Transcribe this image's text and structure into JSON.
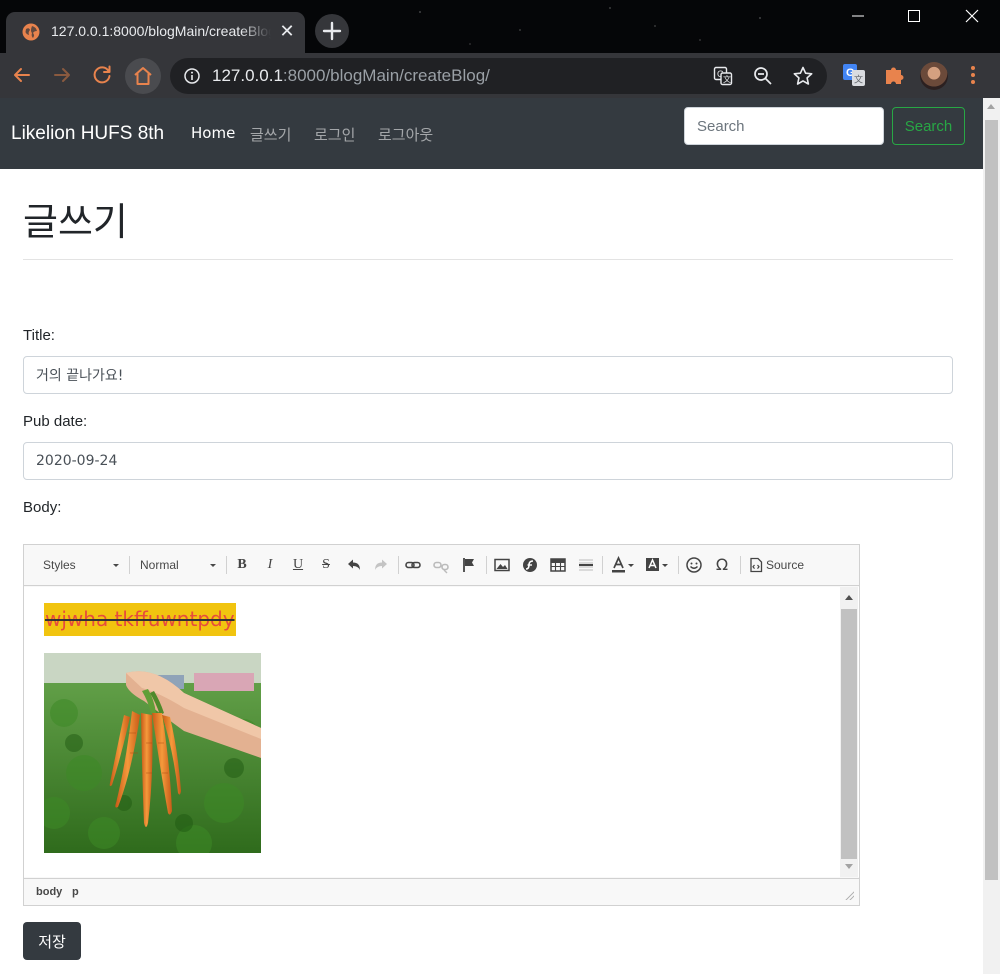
{
  "browser": {
    "tab_title": "127.0.0.1:8000/blogMain/createBlog/",
    "url_host": "127.0.0.1",
    "url_path": ":8000/blogMain/createBlog/"
  },
  "navbar": {
    "brand": "Likelion HUFS 8th",
    "links": [
      {
        "label": "Home",
        "active": true
      },
      {
        "label": "글쓰기",
        "active": false
      },
      {
        "label": "로그인",
        "active": false
      },
      {
        "label": "로그아웃",
        "active": false
      }
    ],
    "search_placeholder": "Search",
    "search_button": "Search"
  },
  "form": {
    "page_title": "글쓰기",
    "title_label": "Title:",
    "title_value": "거의 끝나가요!",
    "pub_date_label": "Pub date:",
    "pub_date_value": "2020-09-24",
    "body_label": "Body:",
    "save_button": "저장"
  },
  "editor": {
    "styles_combo": "Styles",
    "format_combo": "Normal",
    "source_label": "Source",
    "content_text": "wjwha tkffuwntpdy",
    "content_image": "carrot-photo",
    "text_color": "#e74c3c",
    "highlight_color": "#f1c40f",
    "path": [
      "body",
      "p"
    ]
  },
  "colors": {
    "navbar_bg": "#343a40",
    "search_accent": "#28a745"
  }
}
